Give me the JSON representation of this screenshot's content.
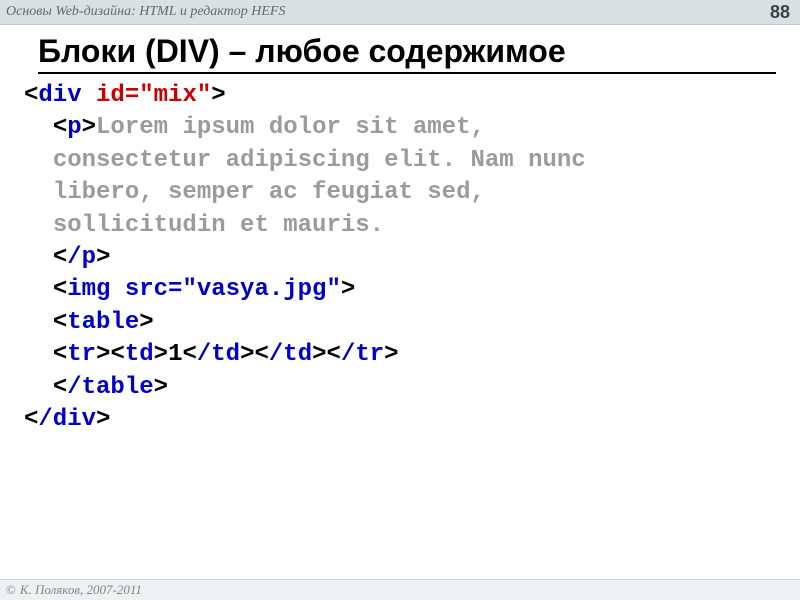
{
  "header": {
    "breadcrumb": "Основы Web-дизайна: HTML и редактор HEFS",
    "page_number": "88"
  },
  "title": "Блоки (DIV) – любое содержимое",
  "code": {
    "lt": "<",
    "gt": ">",
    "div": "div",
    "id_attr": " id=\"mix\"",
    "p": "p",
    "lorem_l1": "Lorem ipsum dolor sit amet,",
    "lorem_l2": "consectetur adipiscing elit. Nam nunc",
    "lorem_l3": "libero, semper ac feugiat sed,",
    "lorem_l4": "sollicitudin et mauris.",
    "p_close": "/p",
    "img_full": "img src=\"vasya.jpg\"",
    "table": "table",
    "tr": "tr",
    "td": "td",
    "one": "1",
    "td_close": "/td",
    "tr_close": "/tr",
    "table_close": "/table",
    "div_close": "/div"
  },
  "footer": {
    "copyright_symbol": "©",
    "copyright_text": "К. Поляков, 2007-2011"
  }
}
